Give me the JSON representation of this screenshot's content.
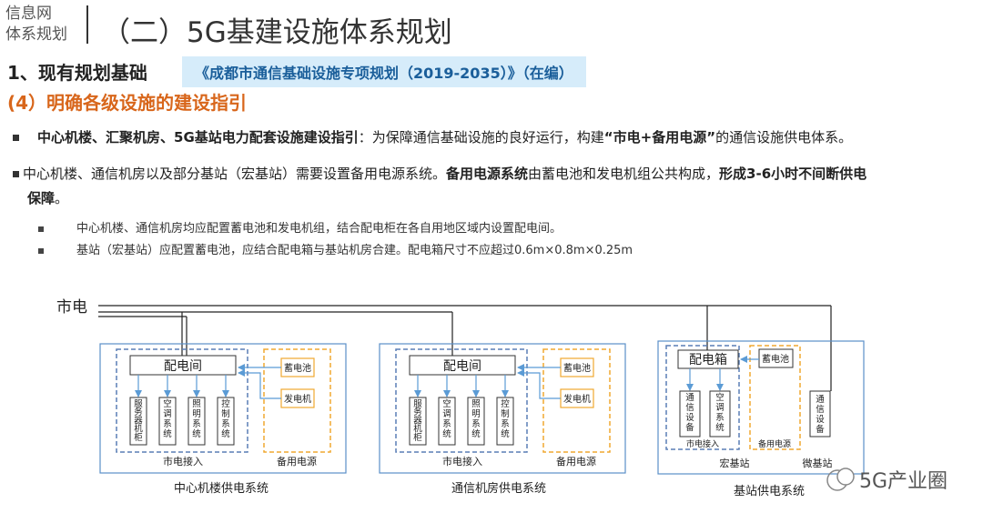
{
  "header": {
    "logo_line1": "信息网",
    "logo_line2": "体系规划",
    "title": "（二）5G基建设施体系规划"
  },
  "section": {
    "title": "1、现有规划基础",
    "plan_name": "《成都市通信基础设施专项规划（2019-2035）》（在编）",
    "subtitle": "(4）明确各级设施的建设指引"
  },
  "bullets": [
    {
      "bold": "中心机楼、汇聚机房、5G基站电力配套设施建设指引",
      "text1": "：为保障通信基础设施的良好运行，构建",
      "bold2": "“市电+备用电源”",
      "text2": "的通信设施供电体系。"
    },
    {
      "text1": "中心机楼、通信机房以及部分基站（宏基站）需要设置备用电源系统。",
      "bold1": "备用电源系统",
      "text2": "由蓄电池和发电机组公共构成，",
      "bold2": "形成3-6小时不间断供电",
      "bold3": "保障",
      "text3": "。"
    }
  ],
  "sub_bullets": [
    "中心机楼、通信机房均应配置蓄电池和发电机组，结合配电柜在各自用地区域内设置配电间。",
    "基站（宏基站）应配置蓄电池，应结合配电箱与基站机房合建。配电箱尺寸不应超过0.6m×0.8m×0.25m"
  ],
  "diagram": {
    "mains_label": "市电",
    "systems": [
      {
        "caption": "中心机楼供电系统",
        "room": "配电间",
        "loads": [
          "服务器机柜",
          "空调系统",
          "照明系统",
          "控制系统"
        ],
        "battery": "蓄电池",
        "generator": "发电机",
        "mains_access": "市电接入",
        "backup": "备用电源"
      },
      {
        "caption": "通信机房供电系统",
        "room": "配电间",
        "loads": [
          "服务器机柜",
          "空调系统",
          "照明系统",
          "控制系统"
        ],
        "battery": "蓄电池",
        "generator": "发电机",
        "mains_access": "市电接入",
        "backup": "备用电源"
      },
      {
        "caption": "基站供电系统",
        "room": "配电箱",
        "loads": [
          "通信设备",
          "空调系统"
        ],
        "battery": "蓄电池",
        "micro_load": "通信设备",
        "mains_access": "市电接入",
        "backup": "备用电源",
        "macro_label": "宏基站",
        "micro_label": "微基站"
      }
    ],
    "colors": {
      "frame": "#5b8fc7",
      "dashed_blue": "#5a7fb5",
      "dashed_orange": "#f0a830",
      "arrow": "#5b9bd5",
      "mains": "#222222"
    }
  },
  "watermark": {
    "text": "5G产业圈"
  }
}
